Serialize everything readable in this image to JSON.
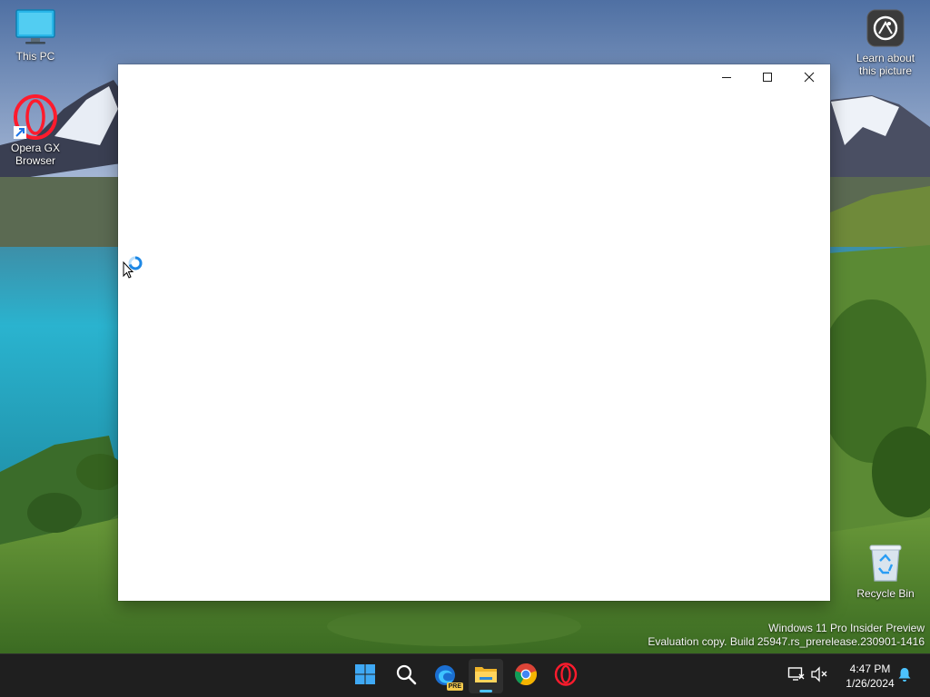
{
  "desktop": {
    "icons": [
      {
        "label": "This PC",
        "icon": "monitor-icon"
      },
      {
        "label": "Opera GX Browser",
        "icon": "opera-gx-icon"
      },
      {
        "label": "Learn about this picture",
        "icon": "learn-picture-icon"
      },
      {
        "label": "Recycle Bin",
        "icon": "recycle-bin-icon"
      }
    ],
    "watermark_line1": "Windows 11 Pro Insider Preview",
    "watermark_line2": "Evaluation copy. Build 25947.rs_prerelease.230901-1416"
  },
  "window": {
    "controls": [
      "minimize-icon",
      "maximize-icon",
      "close-icon"
    ]
  },
  "cursor": {
    "state": "busy"
  },
  "taskbar": {
    "apps": [
      {
        "name": "Start",
        "icon": "windows-logo-icon"
      },
      {
        "name": "Search",
        "icon": "search-icon"
      },
      {
        "name": "Microsoft Edge Preview",
        "icon": "edge-preview-icon",
        "badge": "PRE"
      },
      {
        "name": "File Explorer",
        "icon": "folder-icon",
        "active": true
      },
      {
        "name": "Google Chrome",
        "icon": "chrome-icon"
      },
      {
        "name": "Opera GX",
        "icon": "opera-icon"
      }
    ],
    "tray": {
      "network_icon": "network-icon",
      "volume_icon": "volume-muted-icon",
      "time": "4:47 PM",
      "date": "1/26/2024",
      "notification_icon": "bell-icon"
    }
  },
  "colors": {
    "taskbar_bg": "#1f1f1f",
    "accent": "#4cc2ff",
    "opera_red": "#ff1b2d",
    "window_bg": "#ffffff"
  }
}
